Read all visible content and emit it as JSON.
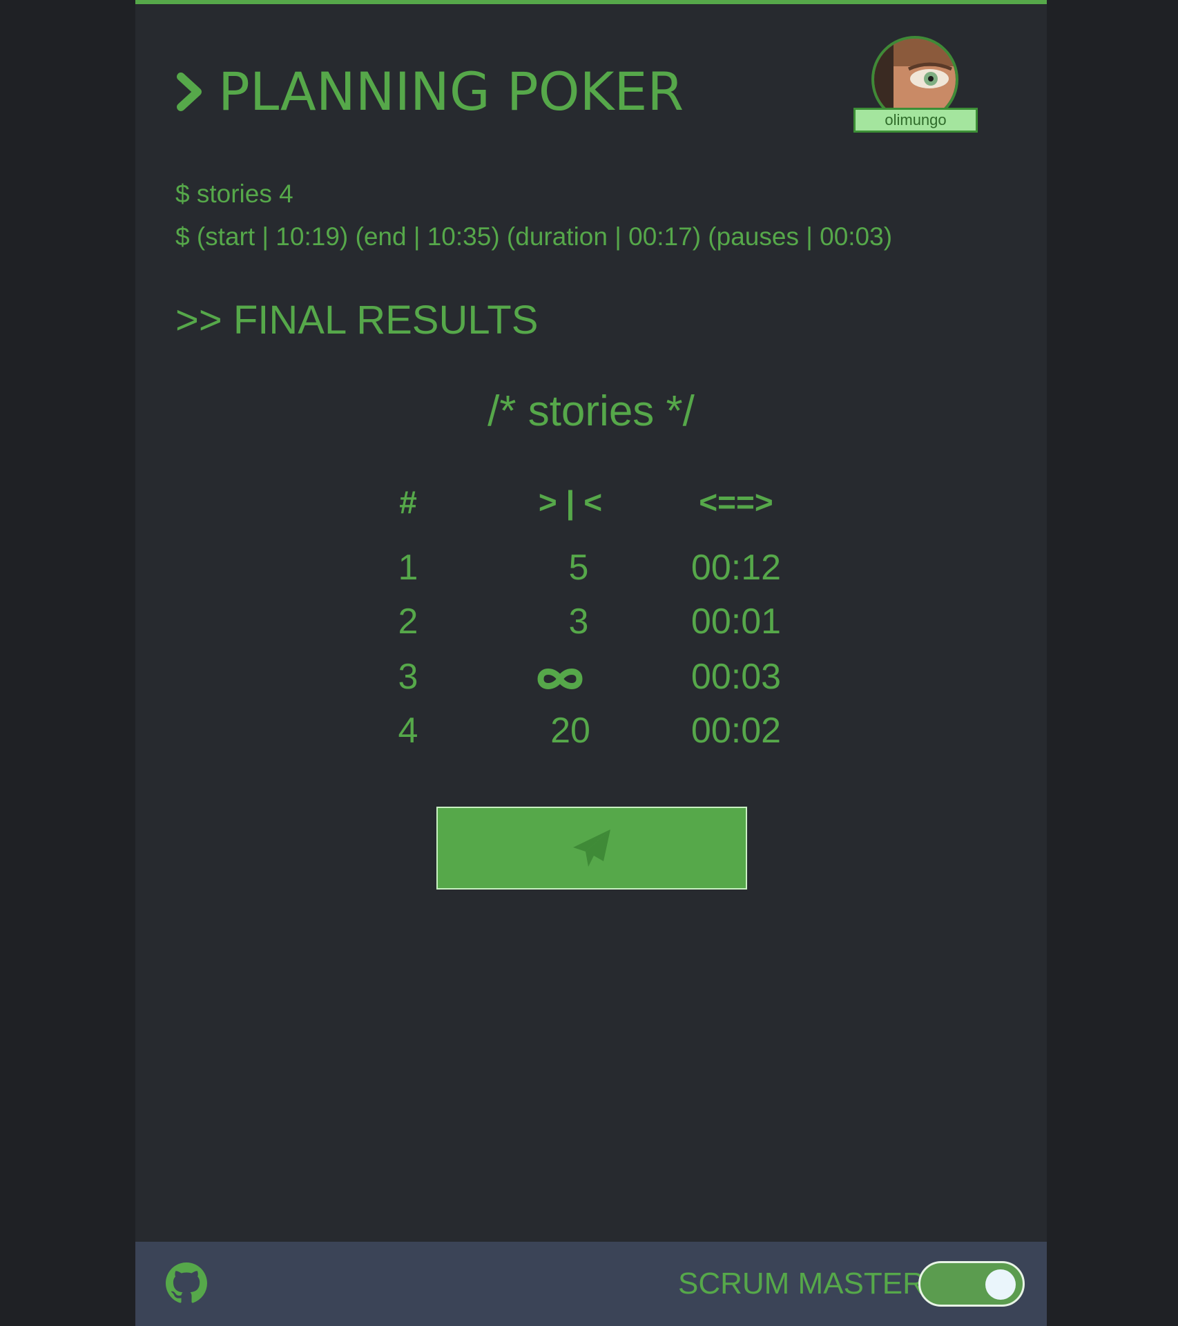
{
  "header": {
    "title": "PLANNING POKER",
    "username": "olimungo"
  },
  "meta": {
    "stories_line": "$ stories 4",
    "times_line": "$ (start | 10:19) (end | 10:35) (duration | 00:17) (pauses | 00:03)"
  },
  "results": {
    "section_title": ">> FINAL RESULTS",
    "table_title": "/* stories */",
    "columns": [
      "#",
      "> | <",
      "<==>"
    ],
    "rows": [
      {
        "num": "1",
        "points": "5",
        "duration": "00:12"
      },
      {
        "num": "2",
        "points": "3",
        "duration": "00:01"
      },
      {
        "num": "3",
        "points": "",
        "points_icon": "infinity-icon",
        "duration": "00:03"
      },
      {
        "num": "4",
        "points": "20",
        "duration": "00:02"
      }
    ]
  },
  "actions": {
    "send_icon": "paper-plane-icon"
  },
  "footer": {
    "github_icon": "github-icon",
    "scrum_master_label": "SCRUM MASTER",
    "scrum_master_enabled": true
  },
  "colors": {
    "accent": "#56a84a",
    "background": "#272a2f",
    "footer": "#3b4457"
  }
}
